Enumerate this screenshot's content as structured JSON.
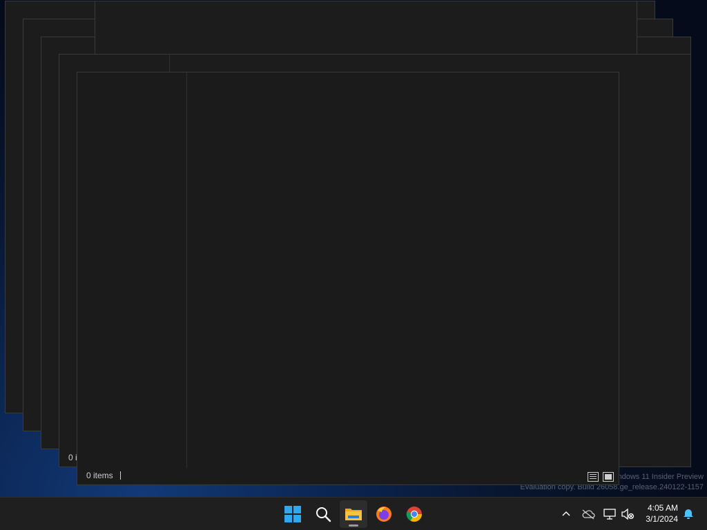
{
  "desktop": {
    "watermark_line1": "Windows 11 Insider Preview",
    "watermark_line2": "Evaluation copy. Build 26058.ge_release.240122-1157"
  },
  "window": {
    "status_items": "0 items",
    "behind_status_items": "0 i"
  },
  "taskbar": {
    "start_icon": "windows-logo-icon",
    "search_icon": "search-icon",
    "apps": [
      {
        "name": "File Explorer",
        "icon": "folder-icon",
        "active": true
      },
      {
        "name": "Firefox",
        "icon": "firefox-icon",
        "active": false
      },
      {
        "name": "Chrome",
        "icon": "chrome-icon",
        "active": false
      }
    ]
  },
  "tray": {
    "overflow_icon": "chevron-up-icon",
    "onedrive_icon": "cloud-offline-icon",
    "network_icon": "network-icon",
    "volume_icon": "volume-muted-icon",
    "time": "4:05 AM",
    "date": "3/1/2024",
    "notification_icon": "bell-icon"
  },
  "colors": {
    "window_bg": "#1c1c1c",
    "taskbar_bg": "#1f1f1f",
    "windows_blue": "#2fa8f0",
    "folder_yellow": "#f5c542"
  }
}
